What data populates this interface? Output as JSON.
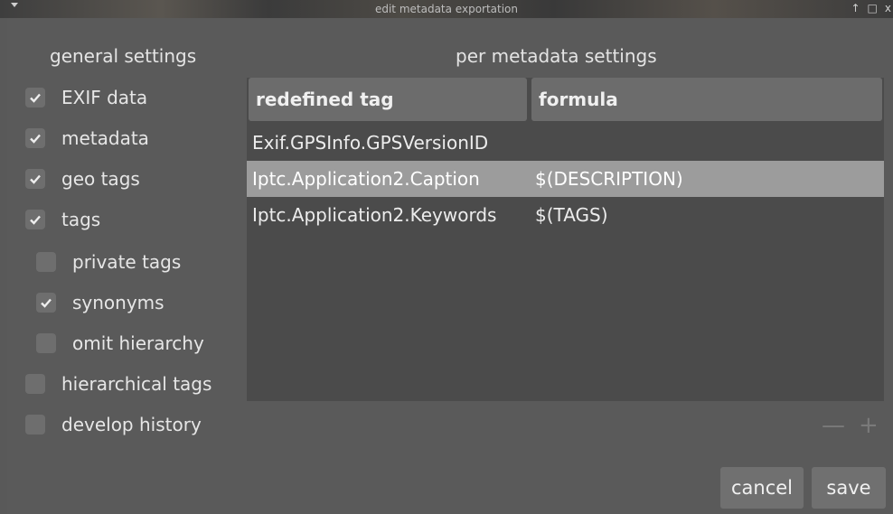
{
  "window": {
    "title": "edit metadata exportation",
    "menu_icon": "chevron-down-icon",
    "buttons": [
      "↑",
      "□",
      "x"
    ]
  },
  "general_settings": {
    "title": "general settings",
    "items": [
      {
        "label": "EXIF data",
        "checked": true
      },
      {
        "label": "metadata",
        "checked": true
      },
      {
        "label": "geo tags",
        "checked": true
      },
      {
        "label": "tags",
        "checked": true
      },
      {
        "label": "private tags",
        "checked": false
      },
      {
        "label": "synonyms",
        "checked": true
      },
      {
        "label": "omit hierarchy",
        "checked": false
      },
      {
        "label": "hierarchical tags",
        "checked": false
      },
      {
        "label": "develop history",
        "checked": false
      }
    ]
  },
  "per_metadata": {
    "title": "per metadata settings",
    "columns": [
      "redefined tag",
      "formula"
    ],
    "rows": [
      {
        "tag": "Exif.GPSInfo.GPSVersionID",
        "formula": "",
        "selected": false
      },
      {
        "tag": "Iptc.Application2.Caption",
        "formula": "$(DESCRIPTION)",
        "selected": true
      },
      {
        "tag": "Iptc.Application2.Keywords",
        "formula": "$(TAGS)",
        "selected": false
      }
    ],
    "remove_label": "—",
    "add_label": "+"
  },
  "actions": {
    "cancel": "cancel",
    "save": "save"
  },
  "colors": {
    "background": "#5a5a5a",
    "table_bg": "#4b4b4b",
    "header_bg": "#6c6c6c",
    "selected_row": "#9c9c9c",
    "button_bg": "#707070"
  }
}
